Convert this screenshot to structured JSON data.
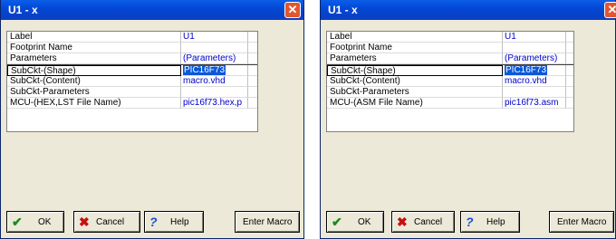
{
  "dialogs": [
    {
      "title": "U1 - x",
      "close_glyph": "✕",
      "rows": [
        {
          "label": "Label",
          "value": ""
        },
        {
          "label": "Footprint Name",
          "value": ""
        },
        {
          "label": "Parameters",
          "value": "(Parameters)"
        },
        {
          "label": "SubCkt-(Shape)",
          "value": "PIC16F73"
        },
        {
          "label": "SubCkt-(Content)",
          "value": "macro.vhd"
        },
        {
          "label": "SubCkt-Parameters",
          "value": ""
        },
        {
          "label": "MCU-(HEX,LST File Name)",
          "value": "pic16f73.hex,p"
        }
      ],
      "label_value": "U1",
      "buttons": {
        "ok": "OK",
        "cancel": "Cancel",
        "help": "Help",
        "macro": "Enter Macro"
      }
    },
    {
      "title": "U1 - x",
      "close_glyph": "✕",
      "rows": [
        {
          "label": "Label",
          "value": ""
        },
        {
          "label": "Footprint Name",
          "value": ""
        },
        {
          "label": "Parameters",
          "value": "(Parameters)"
        },
        {
          "label": "SubCkt-(Shape)",
          "value": "PIC16F73"
        },
        {
          "label": "SubCkt-(Content)",
          "value": "macro.vhd"
        },
        {
          "label": "SubCkt-Parameters",
          "value": ""
        },
        {
          "label": "MCU-(ASM File Name)",
          "value": "pic16f73.asm"
        }
      ],
      "label_value": "U1",
      "buttons": {
        "ok": "OK",
        "cancel": "Cancel",
        "help": "Help",
        "macro": "Enter Macro"
      }
    }
  ]
}
